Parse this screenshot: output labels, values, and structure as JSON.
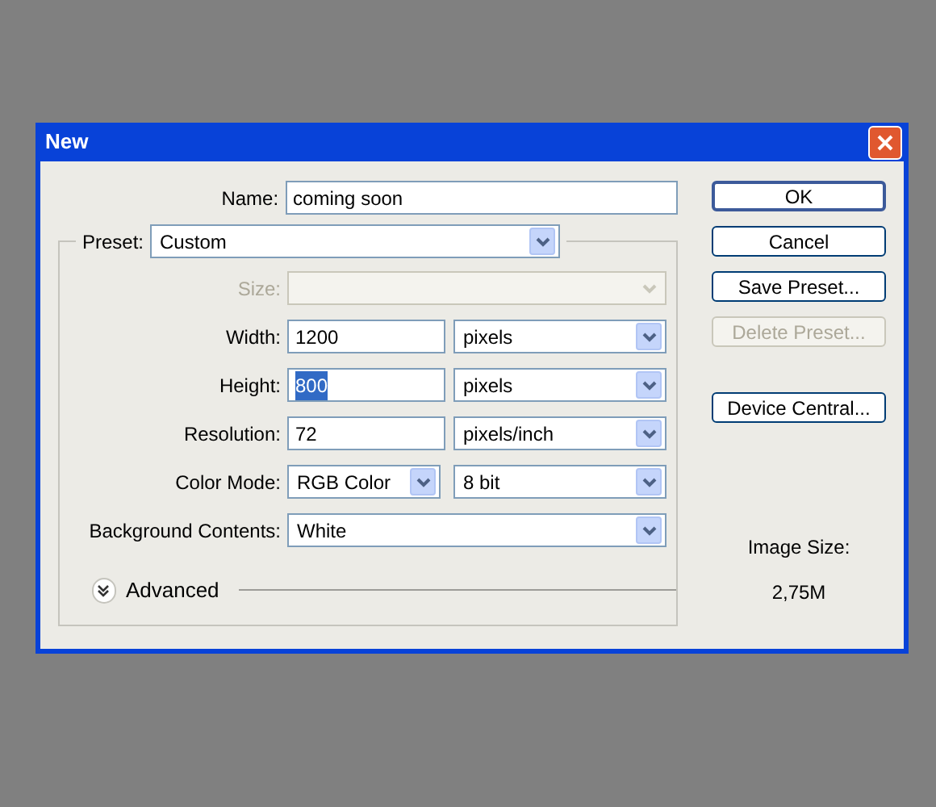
{
  "window": {
    "title": "New"
  },
  "name_field": {
    "label": "Name:",
    "value": "coming soon"
  },
  "preset": {
    "label": "Preset:",
    "value": "Custom"
  },
  "rows": [
    {
      "kind": "select",
      "label": "Size:",
      "value": "",
      "disabled": true
    },
    {
      "kind": "input_unit",
      "label": "Width:",
      "value": "1200",
      "text_selected": false,
      "unit": "pixels"
    },
    {
      "kind": "input_unit",
      "label": "Height:",
      "value": "800",
      "text_selected": true,
      "unit": "pixels"
    },
    {
      "kind": "input_unit",
      "label": "Resolution:",
      "value": "72",
      "text_selected": false,
      "unit": "pixels/inch"
    },
    {
      "kind": "double_select",
      "label": "Color Mode:",
      "value": "RGB Color",
      "unit": "8 bit"
    },
    {
      "kind": "select",
      "label": "Background Contents:",
      "value": "White",
      "disabled": false
    }
  ],
  "advanced": {
    "label": "Advanced",
    "expanded": false
  },
  "buttons": [
    {
      "label": "OK",
      "disabled": false,
      "default": true
    },
    {
      "label": "Cancel",
      "disabled": false,
      "default": false
    },
    {
      "label": "Save Preset...",
      "disabled": false,
      "default": false
    },
    {
      "label": "Delete Preset...",
      "disabled": true,
      "default": false
    },
    {
      "label": "Device Central...",
      "disabled": false,
      "default": false
    }
  ],
  "image_size": {
    "label": "Image Size:",
    "value": "2,75M"
  }
}
